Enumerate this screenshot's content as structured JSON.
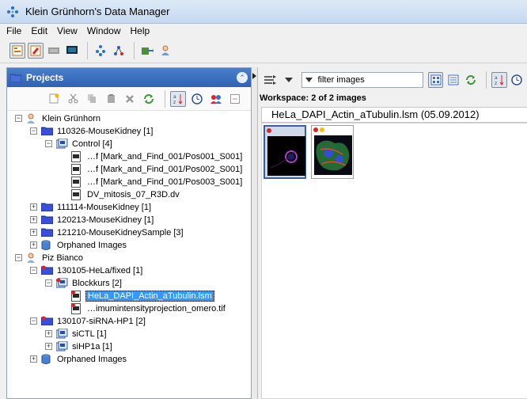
{
  "window": {
    "title": "Klein Grünhorn's Data Manager"
  },
  "menu": [
    "File",
    "Edit",
    "View",
    "Window",
    "Help"
  ],
  "projects_panel": {
    "title": "Projects",
    "tree": [
      {
        "label": "Klein Grünhorn",
        "icon": "user-icon",
        "level": 0,
        "expander": "minus"
      },
      {
        "label": "110326-MouseKidney [1]",
        "icon": "project-folder-icon",
        "level": 1,
        "expander": "minus"
      },
      {
        "label": "Control [4]",
        "icon": "dataset-icon",
        "level": 2,
        "expander": "minus"
      },
      {
        "label": "…f [Mark_and_Find_001/Pos001_S001]",
        "icon": "image-file-icon",
        "level": 3
      },
      {
        "label": "…f [Mark_and_Find_001/Pos002_S001]",
        "icon": "image-file-icon",
        "level": 3
      },
      {
        "label": "…f [Mark_and_Find_001/Pos003_S001]",
        "icon": "image-file-icon",
        "level": 3
      },
      {
        "label": "DV_mitosis_07_R3D.dv",
        "icon": "image-file-icon",
        "level": 3
      },
      {
        "label": "111114-MouseKidney [1]",
        "icon": "project-folder-icon",
        "level": 1,
        "expander": "plus"
      },
      {
        "label": "120213-MouseKidney [1]",
        "icon": "project-folder-icon",
        "level": 1,
        "expander": "plus"
      },
      {
        "label": "121210-MouseKidneySample [3]",
        "icon": "project-folder-icon",
        "level": 1,
        "expander": "plus"
      },
      {
        "label": "Orphaned Images",
        "icon": "orphaned-images-icon",
        "level": 1,
        "expander": "plus"
      },
      {
        "label": "Piz Bianco",
        "icon": "user-icon",
        "level": 0,
        "expander": "minus"
      },
      {
        "label": "130105-HeLa/fixed [1]",
        "icon": "project-folder-red-icon",
        "level": 1,
        "expander": "minus"
      },
      {
        "label": "Blockkurs [2]",
        "icon": "dataset-red-icon",
        "level": 2,
        "expander": "minus"
      },
      {
        "label": "HeLa_DAPI_Actin_aTubulin.lsm",
        "icon": "image-file-red-icon",
        "level": 3,
        "selected": true
      },
      {
        "label": "…imumintensityprojection_omero.tif",
        "icon": "image-file-red-icon",
        "level": 3
      },
      {
        "label": "130107-siRNA-HP1 [2]",
        "icon": "project-folder-red-icon",
        "level": 1,
        "expander": "minus"
      },
      {
        "label": "siCTL [1]",
        "icon": "dataset-icon",
        "level": 2,
        "expander": "plus"
      },
      {
        "label": "siHP1a [1]",
        "icon": "dataset-icon",
        "level": 2,
        "expander": "plus"
      },
      {
        "label": "Orphaned Images",
        "icon": "orphaned-images-icon",
        "level": 1,
        "expander": "plus"
      }
    ]
  },
  "right_panel": {
    "filter_placeholder": "filter  images",
    "workspace_label": "Workspace: 2 of 2 images",
    "image_title": "HeLa_DAPI_Actin_aTubulin.lsm (05.09.2012)"
  },
  "colors": {
    "panel_header": "#2d62b5",
    "selection": "#3399ff",
    "red_dot": "#d9242a",
    "yellow_dot": "#f2c200"
  }
}
